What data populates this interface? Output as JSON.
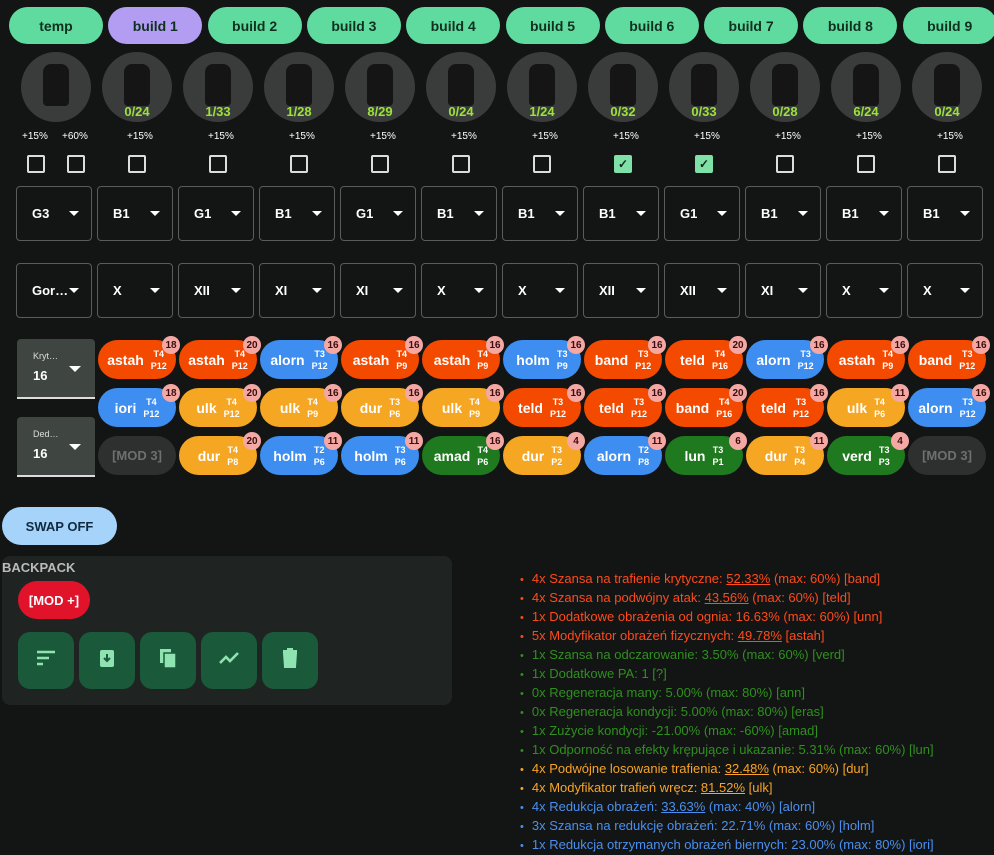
{
  "tabs": [
    "temp",
    "build 1",
    "build 2",
    "build 3",
    "build 4",
    "build 5",
    "build 6",
    "build 7",
    "build 8",
    "build 9"
  ],
  "active_tab": 1,
  "items": [
    {
      "icon": "sword-icon",
      "count": "",
      "pcts": [
        "+15%",
        "+60%"
      ],
      "checks": [
        false,
        false
      ]
    },
    {
      "icon": "helmet-icon",
      "count": "0/24",
      "pcts": [
        "+15%"
      ],
      "checks": [
        false
      ]
    },
    {
      "icon": "armor-icon",
      "count": "1/33",
      "pcts": [
        "+15%"
      ],
      "checks": [
        false
      ]
    },
    {
      "icon": "pants-icon",
      "count": "1/28",
      "pcts": [
        "+15%"
      ],
      "checks": [
        false
      ]
    },
    {
      "icon": "boots-icon",
      "count": "8/29",
      "pcts": [
        "+15%"
      ],
      "checks": [
        false
      ]
    },
    {
      "icon": "shield-icon",
      "count": "0/24",
      "pcts": [
        "+15%"
      ],
      "checks": [
        false
      ]
    },
    {
      "icon": "belt-icon",
      "count": "1/24",
      "pcts": [
        "+15%"
      ],
      "checks": [
        false
      ]
    },
    {
      "icon": "cape-icon",
      "count": "0/32",
      "pcts": [
        "+15%"
      ],
      "checks": [
        true
      ]
    },
    {
      "icon": "gloves-icon",
      "count": "0/33",
      "pcts": [
        "+15%"
      ],
      "checks": [
        true
      ]
    },
    {
      "icon": "amulet-icon",
      "count": "0/28",
      "pcts": [
        "+15%"
      ],
      "checks": [
        false
      ]
    },
    {
      "icon": "ring-icon",
      "count": "6/24",
      "pcts": [
        "+15%"
      ],
      "checks": [
        false
      ]
    },
    {
      "icon": "ring-icon",
      "count": "0/24",
      "pcts": [
        "+15%"
      ],
      "checks": [
        false
      ]
    }
  ],
  "grades": [
    "G3",
    "B1",
    "G1",
    "B1",
    "G1",
    "B1",
    "B1",
    "B1",
    "G1",
    "B1",
    "B1",
    "B1"
  ],
  "levels": [
    "Gor…",
    "X",
    "XII",
    "XI",
    "XI",
    "X",
    "X",
    "XII",
    "XII",
    "XI",
    "X",
    "X"
  ],
  "left_selects": [
    {
      "label": "Kryt…",
      "value": "16"
    },
    {
      "label": "Ded…",
      "value": "16"
    }
  ],
  "colors": {
    "red": "#f44a00",
    "blue": "#3d8ef0",
    "yellow": "#f5a623",
    "green": "#1f7a1f"
  },
  "chip_rows": [
    [
      [
        "astah",
        "T4",
        "P12",
        "18",
        "red"
      ],
      [
        "astah",
        "T4",
        "P12",
        "20",
        "red"
      ],
      [
        "alorn",
        "T3",
        "P12",
        "16",
        "blue"
      ],
      [
        "astah",
        "T4",
        "P9",
        "16",
        "red"
      ],
      [
        "astah",
        "T4",
        "P9",
        "16",
        "red"
      ],
      [
        "holm",
        "T3",
        "P9",
        "16",
        "blue"
      ],
      [
        "band",
        "T3",
        "P12",
        "16",
        "red"
      ],
      [
        "teld",
        "T4",
        "P16",
        "20",
        "red"
      ],
      [
        "alorn",
        "T3",
        "P12",
        "16",
        "blue"
      ],
      [
        "astah",
        "T4",
        "P9",
        "16",
        "red"
      ],
      [
        "band",
        "T3",
        "P12",
        "16",
        "red"
      ]
    ],
    [
      [
        "iori",
        "T4",
        "P12",
        "18",
        "blue"
      ],
      [
        "ulk",
        "T4",
        "P12",
        "20",
        "yellow"
      ],
      [
        "ulk",
        "T4",
        "P9",
        "16",
        "yellow"
      ],
      [
        "dur",
        "T3",
        "P6",
        "16",
        "yellow"
      ],
      [
        "ulk",
        "T4",
        "P9",
        "16",
        "yellow"
      ],
      [
        "teld",
        "T3",
        "P12",
        "16",
        "red"
      ],
      [
        "teld",
        "T3",
        "P12",
        "16",
        "red"
      ],
      [
        "band",
        "T4",
        "P16",
        "20",
        "red"
      ],
      [
        "teld",
        "T3",
        "P12",
        "16",
        "red"
      ],
      [
        "ulk",
        "T4",
        "P6",
        "11",
        "yellow"
      ],
      [
        "alorn",
        "T3",
        "P12",
        "16",
        "blue"
      ]
    ],
    [
      [
        "[MOD 3]"
      ],
      [
        "dur",
        "T4",
        "P8",
        "20",
        "yellow"
      ],
      [
        "holm",
        "T2",
        "P6",
        "11",
        "blue"
      ],
      [
        "holm",
        "T3",
        "P6",
        "11",
        "blue"
      ],
      [
        "amad",
        "T4",
        "P6",
        "16",
        "green"
      ],
      [
        "dur",
        "T3",
        "P2",
        "4",
        "yellow"
      ],
      [
        "alorn",
        "T2",
        "P8",
        "11",
        "blue"
      ],
      [
        "lun",
        "T3",
        "P1",
        "6",
        "green"
      ],
      [
        "dur",
        "T3",
        "P4",
        "11",
        "yellow"
      ],
      [
        "verd",
        "T3",
        "P3",
        "4",
        "green"
      ],
      [
        "[MOD 3]"
      ]
    ]
  ],
  "swap_label": "SWAP OFF",
  "backpack": {
    "title": "BACKPACK",
    "mod_label": "[MOD +]",
    "buttons": [
      "sort-icon",
      "clipboard-download-icon",
      "copy-icon",
      "trending-icon",
      "delete-icon"
    ]
  },
  "stats": [
    {
      "c": "r",
      "pre": "4x Szansa na trafienie krytyczne: ",
      "val": "52.33%",
      "post": " (max: 60%) [band]"
    },
    {
      "c": "r",
      "pre": "4x Szansa na podwójny atak: ",
      "val": "43.56%",
      "post": " (max: 60%) [teld]"
    },
    {
      "c": "r",
      "pre": "1x Dodatkowe obrażenia od ognia: 16.63% (max: 60%) [unn]"
    },
    {
      "c": "r",
      "pre": "5x Modyfikator obrażeń fizycznych: ",
      "val": "49.78%",
      "post": " [astah]"
    },
    {
      "c": "g",
      "pre": "1x Szansa na odczarowanie: 3.50% (max: 60%) [verd]"
    },
    {
      "c": "g",
      "pre": "1x Dodatkowe PA: 1 [?]"
    },
    {
      "c": "g",
      "pre": "0x Regeneracja many: 5.00% (max: 80%) [ann]"
    },
    {
      "c": "g",
      "pre": "0x Regeneracja kondycji: 5.00% (max: 80%) [eras]"
    },
    {
      "c": "g",
      "pre": "1x Zużycie kondycji: -21.00% (max: -60%) [amad]"
    },
    {
      "c": "g",
      "pre": "1x Odporność na efekty krępujące i ukazanie: 5.31% (max: 60%) [lun]"
    },
    {
      "c": "y",
      "pre": "4x Podwójne losowanie trafienia: ",
      "val": "32.48%",
      "post": " (max: 60%) [dur]"
    },
    {
      "c": "y",
      "pre": "4x Modyfikator trafień wręcz: ",
      "val": "81.52%",
      "post": " [ulk]"
    },
    {
      "c": "bl",
      "pre": "4x Redukcja obrażeń: ",
      "val": "33.63%",
      "post": " (max: 40%) [alorn]"
    },
    {
      "c": "bl",
      "pre": "3x Szansa na redukcję obrażeń: 22.71% (max: 60%) [holm]"
    },
    {
      "c": "bl",
      "pre": "1x Redukcja otrzymanych obrażeń biernych: 23.00% (max: 80%) [iori]"
    }
  ]
}
